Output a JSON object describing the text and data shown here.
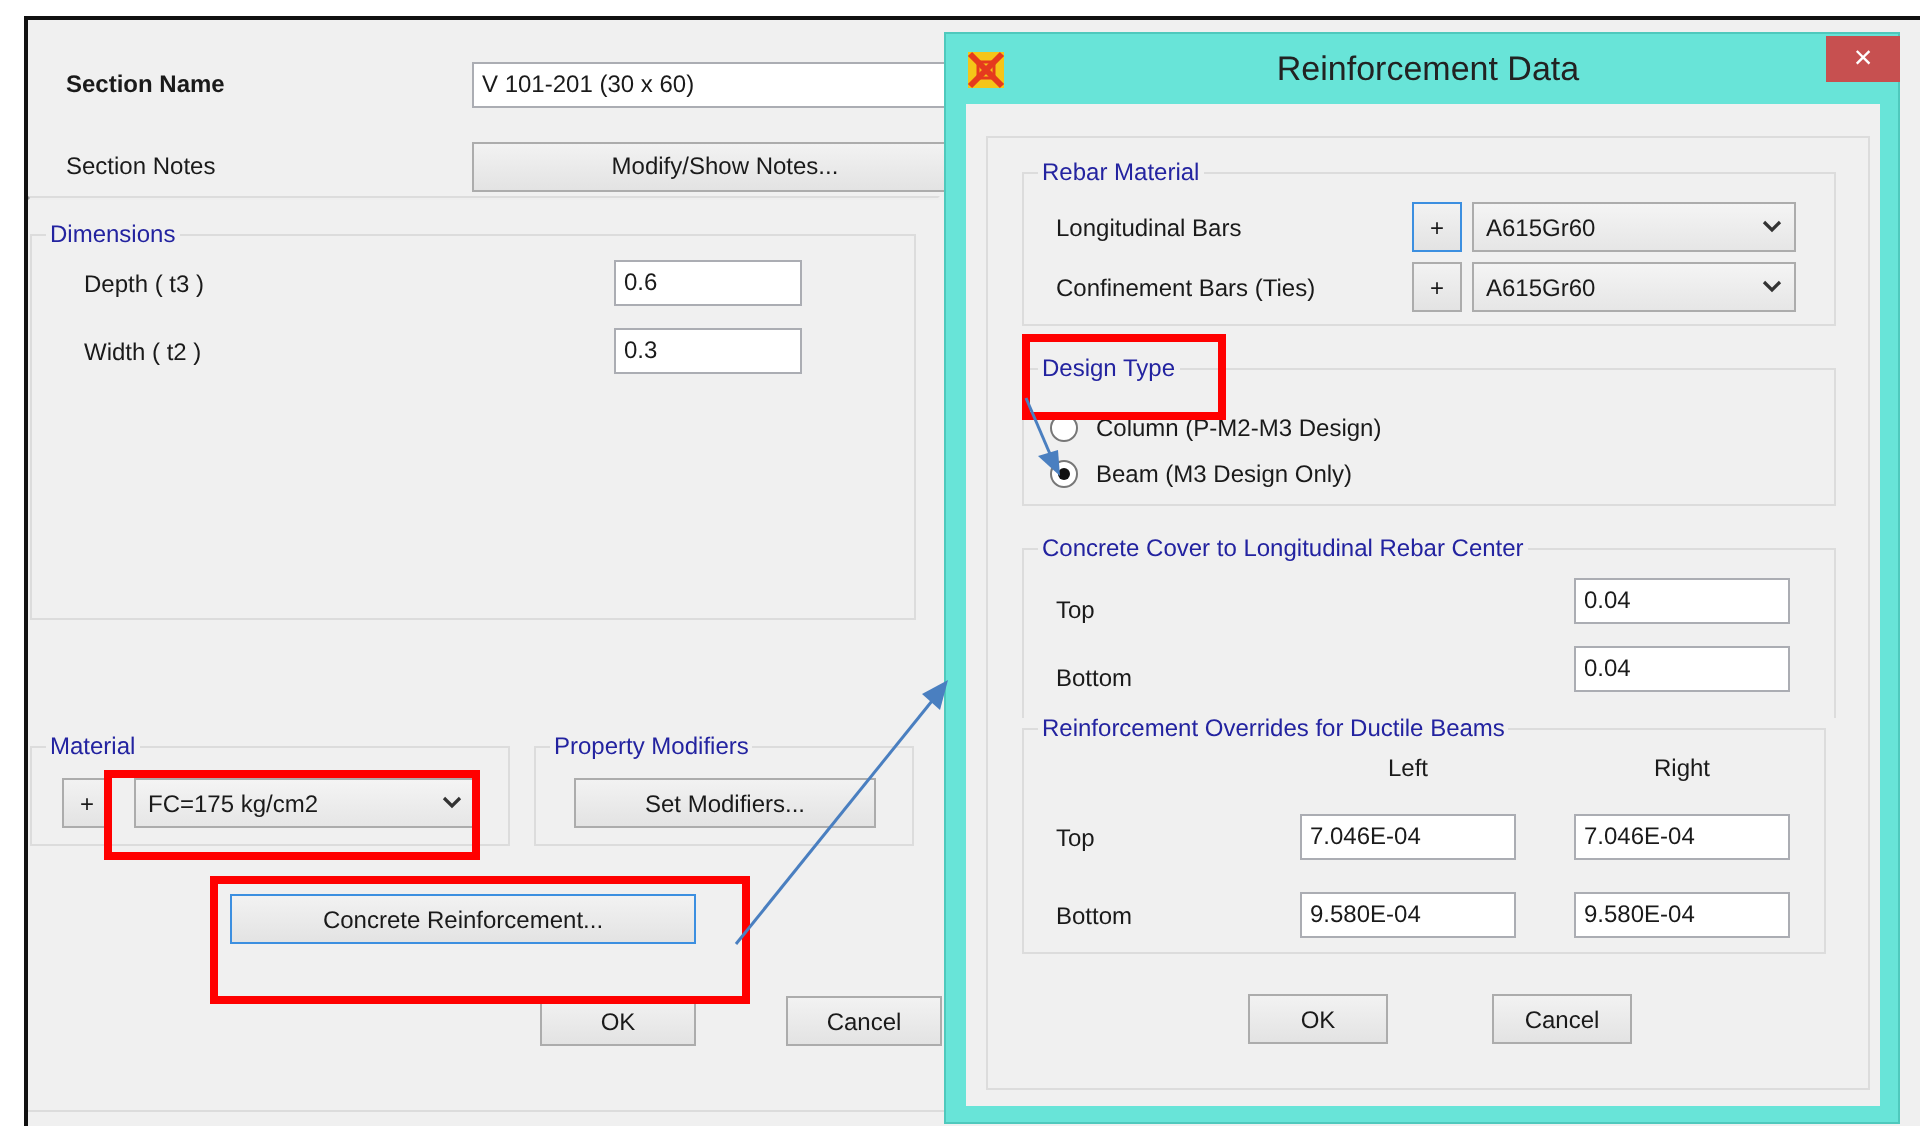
{
  "section_dialog": {
    "section_name": {
      "label": "Section Name",
      "value": "V 101-201 (30 x 60)"
    },
    "section_notes": {
      "label": "Section Notes",
      "button": "Modify/Show Notes..."
    },
    "dimensions": {
      "title": "Dimensions",
      "fields": [
        {
          "label": "Depth  ( t3 )",
          "value": "0.6"
        },
        {
          "label": "Width  ( t2 )",
          "value": "0.3"
        }
      ]
    },
    "material": {
      "title": "Material",
      "add_button": "+",
      "value": "FC=175 kg/cm2"
    },
    "property_modifiers": {
      "title": "Property Modifiers",
      "button": "Set Modifiers..."
    },
    "reinforcement_button": {
      "label": "Concrete Reinforcement...",
      "focused": true
    },
    "buttons": [
      "OK",
      "Cancel"
    ]
  },
  "reinforcement_dialog": {
    "title": "Reinforcement Data",
    "close": "×",
    "rebar_material": {
      "title": "Rebar Material",
      "rows": [
        {
          "label": "Longitudinal Bars",
          "add_button": "+",
          "focused": true,
          "value": "A615Gr60"
        },
        {
          "label": "Confinement Bars  (Ties)",
          "add_button": "+",
          "focused": false,
          "value": "A615Gr60"
        }
      ]
    },
    "design_type": {
      "title": "Design Type",
      "options": [
        {
          "label": "Column  (P-M2-M3 Design)",
          "selected": false
        },
        {
          "label": "Beam  (M3 Design Only)",
          "selected": true
        }
      ]
    },
    "concrete_cover": {
      "title": "Concrete Cover to Longitudinal Rebar Center",
      "rows": [
        {
          "label": "Top",
          "value": "0.04"
        },
        {
          "label": "Bottom",
          "value": "0.04"
        }
      ]
    },
    "overrides": {
      "title": "Reinforcement Overrides for Ductile Beams",
      "columns": [
        "Left",
        "Right"
      ],
      "rows": [
        {
          "label": "Top",
          "values": [
            "7.046E-04",
            "7.046E-04"
          ]
        },
        {
          "label": "Bottom",
          "values": [
            "9.580E-04",
            "9.580E-04"
          ]
        }
      ]
    },
    "buttons": [
      "OK",
      "Cancel"
    ]
  }
}
